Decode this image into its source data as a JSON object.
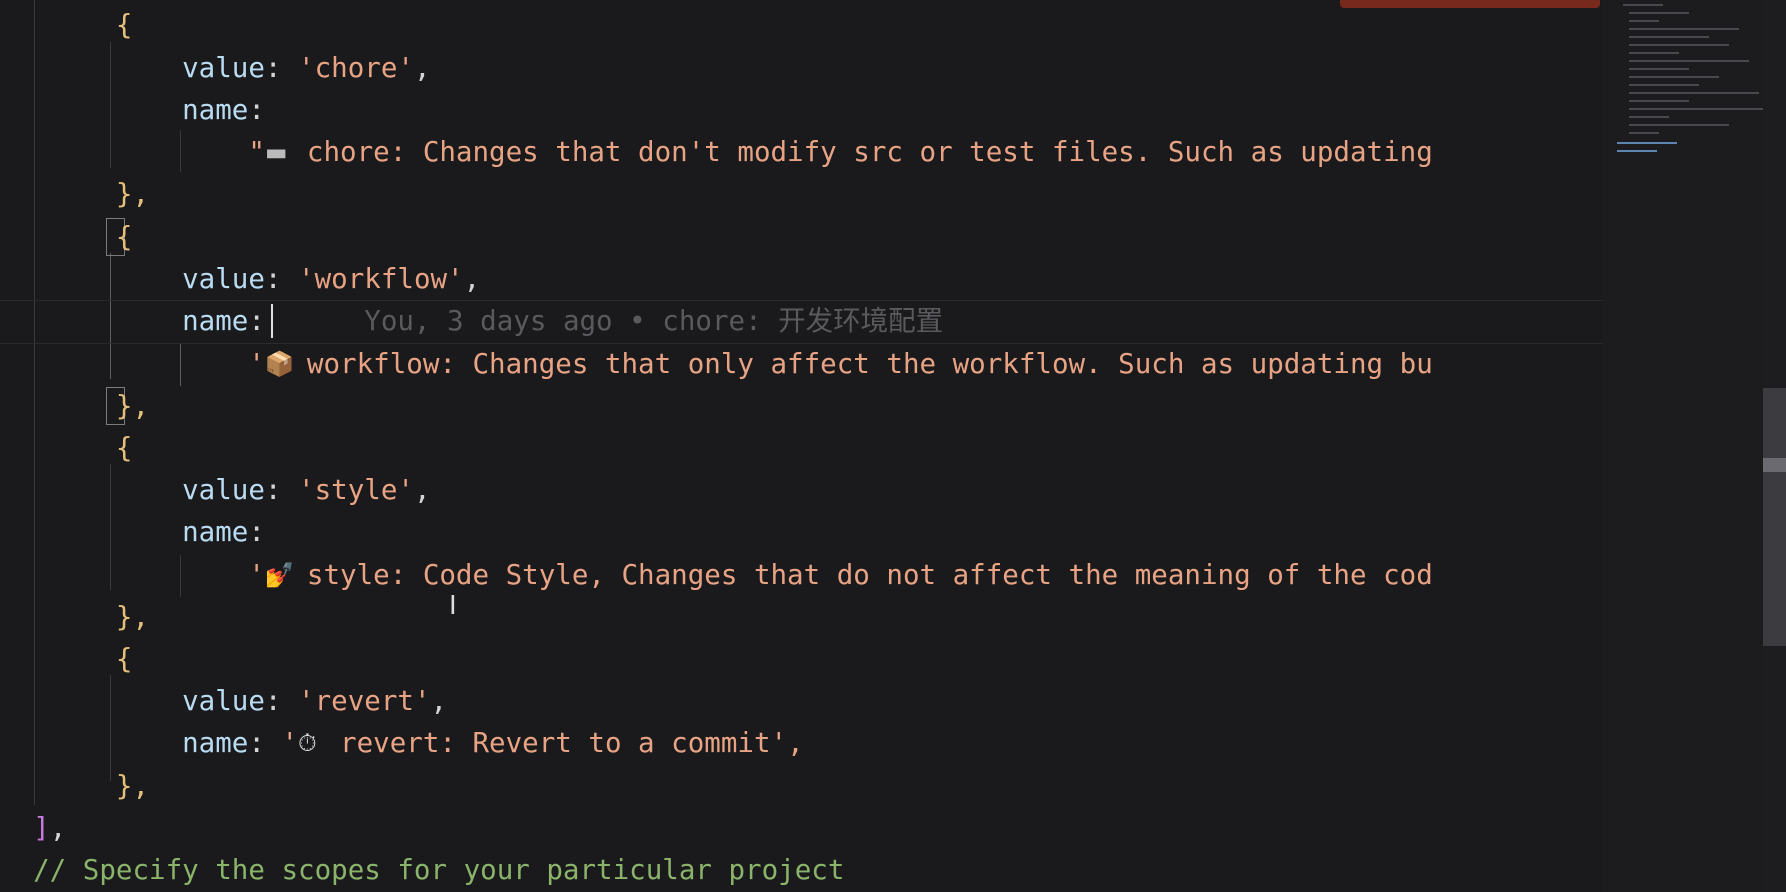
{
  "editor": {
    "blame_annotation": "You, 3 days ago • chore: 开发环境配置",
    "lines": {
      "l0_brace": "{",
      "l1_key": "value",
      "l1_val": "'chore'",
      "l2_key": "name",
      "l3_quote": "\"",
      "l3_emoji": "▬",
      "l3_text": "chore: Changes that don't modify src or test files. Such as updating",
      "l4_close": "},",
      "l5_brace": "{",
      "l6_key": "value",
      "l6_val": "'workflow'",
      "l7_key": "name",
      "l8_quote": "'",
      "l8_emoji": "📦",
      "l8_text": "workflow: Changes that only affect the workflow. Such as updating bu",
      "l9_close": "},",
      "l10_brace": "{",
      "l11_key": "value",
      "l11_val": "'style'",
      "l12_key": "name",
      "l13_quote": "'",
      "l13_emoji": "💅",
      "l13_text": "style: Code Style, Changes that do not affect the meaning of the cod",
      "l14_close": "},",
      "l15_brace": "{",
      "l16_key": "value",
      "l16_val": "'revert'",
      "l17_key": "name",
      "l17_quote": "'",
      "l17_emoji": "⏱",
      "l17_text": "revert: Revert to a commit',",
      "l18_close": "},",
      "l19_bracket": "]",
      "l20_comment": "// Specify the scopes for your particular project"
    }
  },
  "icons": {
    "mouse_cursor": "text-ibeam-cursor"
  },
  "colors": {
    "background": "#1a1a1c",
    "key": "#b9dcf2",
    "string": "#e8a384",
    "comment": "#8ab46a",
    "brace": "#e5c07b",
    "bracket": "#c678dd"
  }
}
